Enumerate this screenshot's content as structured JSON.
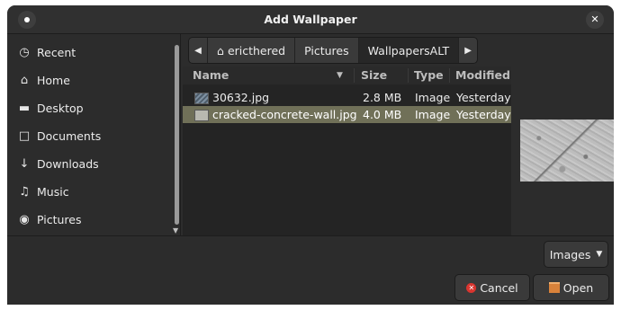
{
  "window": {
    "title": "Add Wallpaper"
  },
  "sidebar": {
    "items": [
      {
        "label": "Recent",
        "icon": "clock-icon"
      },
      {
        "label": "Home",
        "icon": "home-icon"
      },
      {
        "label": "Desktop",
        "icon": "folder-icon"
      },
      {
        "label": "Documents",
        "icon": "document-icon"
      },
      {
        "label": "Downloads",
        "icon": "download-icon"
      },
      {
        "label": "Music",
        "icon": "music-icon"
      },
      {
        "label": "Pictures",
        "icon": "camera-icon"
      }
    ]
  },
  "pathbar": {
    "segments": [
      "ericthered",
      "Pictures",
      "WallpapersALT"
    ]
  },
  "filelist": {
    "columns": [
      "Name",
      "Size",
      "Type",
      "Modified"
    ],
    "rows": [
      {
        "name": "30632.jpg",
        "size": "2.8 MB",
        "type": "Image",
        "modified": "Yesterday"
      },
      {
        "name": "cracked-concrete-wall.jpg",
        "size": "4.0 MB",
        "type": "Image",
        "modified": "Yesterday"
      }
    ]
  },
  "filter": {
    "label": "Images"
  },
  "buttons": {
    "cancel": "Cancel",
    "open": "Open"
  },
  "colors": {
    "selection": "#707058",
    "cancel_icon": "#d9352f",
    "open_icon": "#d9823a"
  }
}
